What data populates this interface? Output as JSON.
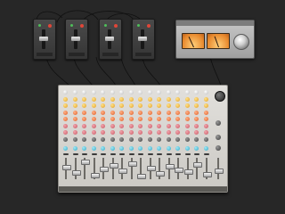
{
  "scene": {
    "strip_modules": [
      {
        "name": "strip-module-1"
      },
      {
        "name": "strip-module-2"
      },
      {
        "name": "strip-module-3"
      },
      {
        "name": "strip-module-4"
      }
    ],
    "vu_unit": {
      "meters": 2
    },
    "mixer": {
      "channels": 16
    },
    "colors": {
      "background": "#272727",
      "meter_face": "#e8892d",
      "mixer_body": "#dcdad6",
      "lamp_red": "#e04638",
      "lamp_green": "#4fbf5a",
      "knob_yellow": "#e2a024",
      "knob_orange": "#e0602b",
      "knob_pink": "#c95763",
      "knob_cyan": "#2fa9c9"
    }
  }
}
